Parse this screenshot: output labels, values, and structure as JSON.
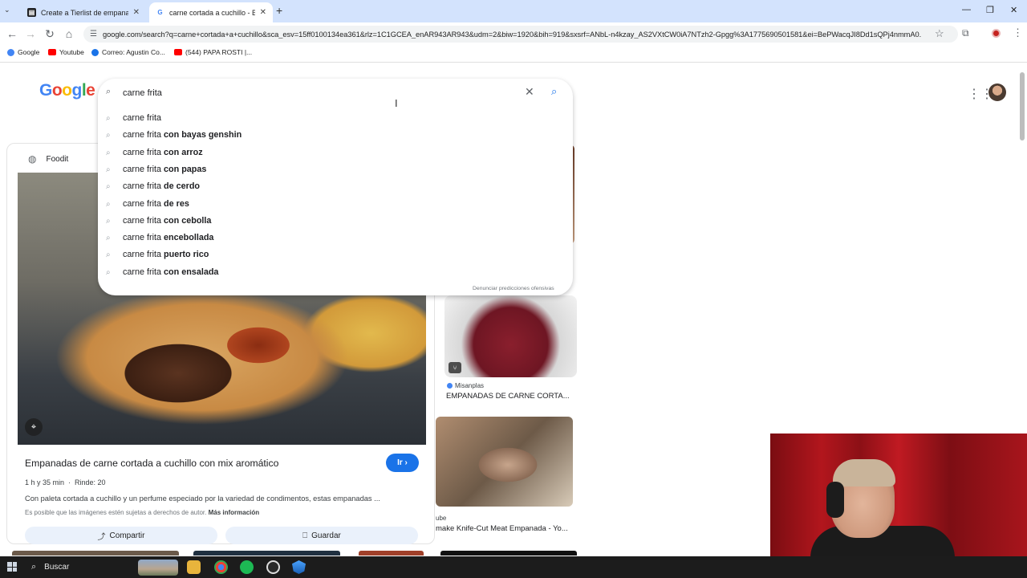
{
  "browser": {
    "tabs": [
      {
        "title": "Create a Tierlist de empanadas",
        "favicon_color": "#202124"
      },
      {
        "title": "carne cortada a cuchillo - Busca",
        "favicon_color": "#4285f4"
      }
    ],
    "url": "google.com/search?q=carne+cortada+a+cuchillo&sca_esv=15ff0100134ea361&rlz=1C1GCEA_enAR943AR943&udm=2&biw=1920&bih=919&sxsrf=ANbL-n4kzay_AS2VXtCW0iA7NTzh2-Gpgg%3A1775690501581&ei=BePWacqJI8Dd1sQPj4nmmA0...",
    "bookmarks": [
      {
        "label": "Google",
        "color": "#4285f4"
      },
      {
        "label": "Youtube",
        "color": "#ff0000"
      },
      {
        "label": "Correo: Agustin Co...",
        "color": "#1a73e8"
      },
      {
        "label": "(544) PAPA ROSTI |...",
        "color": "#ff0000"
      }
    ]
  },
  "google": {
    "logo": "Google",
    "search": {
      "value": "carne frita",
      "placeholder": ""
    },
    "suggestions": [
      {
        "prefix": "carne frita",
        "bold": ""
      },
      {
        "prefix": "carne frita",
        "bold": "con bayas genshin"
      },
      {
        "prefix": "carne frita",
        "bold": "con arroz"
      },
      {
        "prefix": "carne frita",
        "bold": "con papas"
      },
      {
        "prefix": "carne frita",
        "bold": "de cerdo"
      },
      {
        "prefix": "carne frita",
        "bold": "de res"
      },
      {
        "prefix": "carne frita",
        "bold": "con cebolla"
      },
      {
        "prefix": "carne frita",
        "bold": "encebollada"
      },
      {
        "prefix": "carne frita",
        "bold": "puerto rico"
      },
      {
        "prefix": "carne frita",
        "bold": "con ensalada"
      }
    ],
    "report_link": "Denunciar predicciones ofensivas"
  },
  "preview": {
    "source": "Foodit",
    "title": "Empanadas de carne cortada a cuchillo con mix aromático",
    "go_button": "Ir",
    "time": "1 h y 35 min",
    "yield": "Rinde: 20",
    "description": "Con paleta cortada a cuchillo y un perfume especiado por la variedad de condimentos, estas empanadas ...",
    "rights": "Es posible que las imágenes estén sujetas a derechos de autor.",
    "more_info": "Más información",
    "share": "Compartir",
    "save": "Guardar"
  },
  "results": {
    "item1": {
      "source": "Misanplas",
      "title": "EMPANADAS DE CARNE CORTA..."
    },
    "item2": {
      "source": "ube",
      "title": "make Knife-Cut Meat Empanada - Yo..."
    }
  },
  "taskbar": {
    "search_label": "Buscar"
  }
}
